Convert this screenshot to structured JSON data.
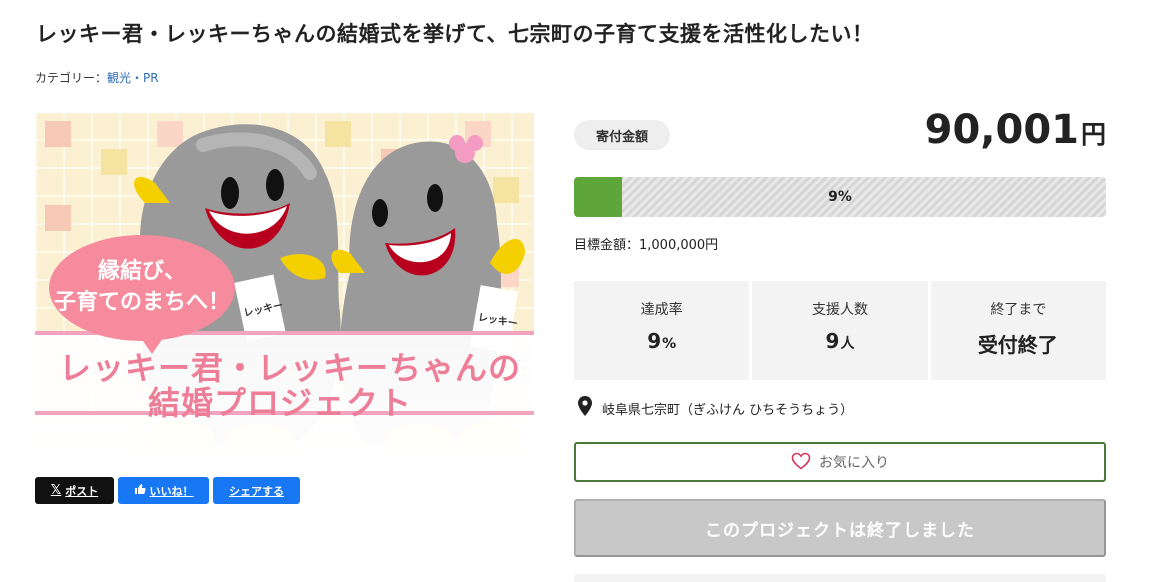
{
  "project": {
    "title": "レッキー君・レッキーちゃんの結婚式を挙げて、七宗町の子育て支援を活性化したい！",
    "category_label": "カテゴリー：",
    "category_value": "観光・PR"
  },
  "hero": {
    "bubble_line1": "縁結び、",
    "bubble_line2": "子育てのまちへ！",
    "headline1": "レッキー君・レッキーちゃんの",
    "headline2": "結婚プロジェクト",
    "sash_left": "レッキー",
    "sash_right": "レッキー"
  },
  "share": {
    "x_label": "ポスト",
    "like_label": "いいね！",
    "share_label": "シェアする"
  },
  "funding": {
    "label": "寄付金額",
    "amount": "90,001",
    "unit": "円",
    "progress_percent": 9,
    "progress_text": "9%",
    "target_text": "目標金額：1,000,000円"
  },
  "stats": [
    {
      "label": "達成率",
      "value": "9",
      "unit": "%"
    },
    {
      "label": "支援人数",
      "value": "9",
      "unit": "人"
    },
    {
      "label": "終了まで",
      "value": "受付終了",
      "unit": ""
    }
  ],
  "location": "岐阜県七宗町（ぎふけん ひちそうちょう）",
  "favorite_label": "お気に入り",
  "ended_label": "このプロジェクトは終了しました",
  "colors": {
    "progress": "#5ea53a",
    "favorite_border": "#4a7a3a",
    "link": "#2f6db5",
    "pink": "#ee7e97"
  }
}
